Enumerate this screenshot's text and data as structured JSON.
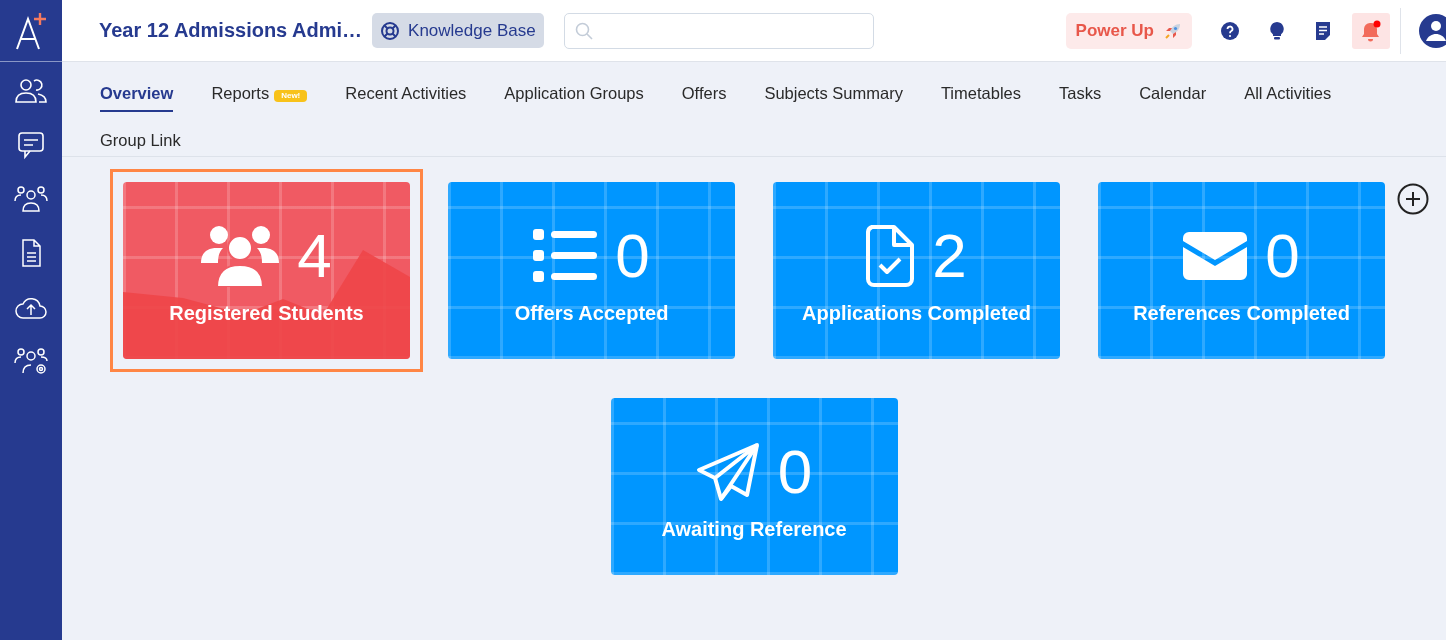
{
  "header": {
    "title": "Year 12 Admissions Admi…",
    "knowledge_base": "Knowledge Base",
    "power_up": "Power Up",
    "notifications": {
      "unread": true
    }
  },
  "tabs": [
    {
      "label": "Overview",
      "selected": true
    },
    {
      "label": "Reports",
      "selected": false,
      "badge": "New!"
    },
    {
      "label": "Recent Activities",
      "selected": false
    },
    {
      "label": "Application Groups",
      "selected": false
    },
    {
      "label": "Offers",
      "selected": false
    },
    {
      "label": "Subjects Summary",
      "selected": false
    },
    {
      "label": "Timetables",
      "selected": false
    },
    {
      "label": "Tasks",
      "selected": false
    },
    {
      "label": "Calendar",
      "selected": false
    },
    {
      "label": "All Activities",
      "selected": false
    },
    {
      "label": "Group Link",
      "selected": false
    }
  ],
  "cards": [
    {
      "kind": "students",
      "count": "4",
      "label": "Registered Students",
      "selected": true,
      "color": "#f05a63"
    },
    {
      "kind": "list",
      "count": "0",
      "label": "Offers Accepted",
      "selected": false,
      "color": "#0096ff"
    },
    {
      "kind": "document",
      "count": "2",
      "label": "Applications Completed",
      "selected": false,
      "color": "#0096ff"
    },
    {
      "kind": "mail",
      "count": "0",
      "label": "References Completed",
      "selected": false,
      "color": "#0096ff"
    },
    {
      "kind": "plane",
      "count": "0",
      "label": "Awaiting Reference",
      "selected": false,
      "color": "#0096ff"
    }
  ]
}
